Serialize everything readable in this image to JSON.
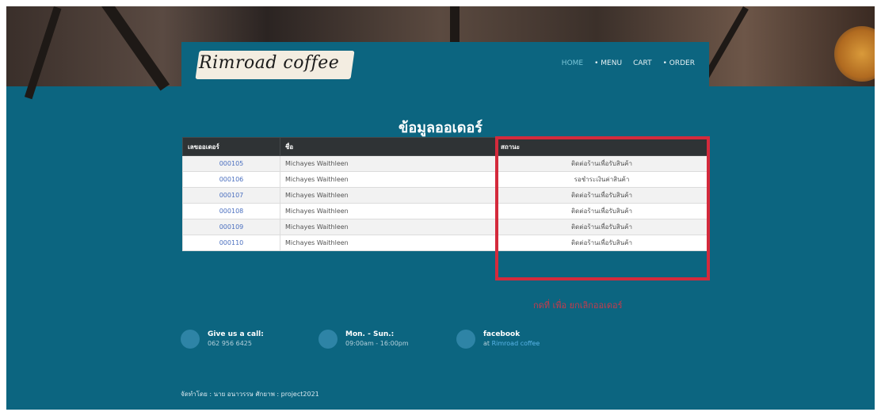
{
  "brand": {
    "logo_text": "Rimroad coffee"
  },
  "nav": {
    "items": [
      "HOME",
      "MENU",
      "CART",
      "ORDER"
    ]
  },
  "page_title": "ข้อมูลออเดอร์",
  "table": {
    "headers": [
      "เลขออเดอร์",
      "ชื่อ",
      "สถานะ"
    ],
    "rows": [
      {
        "number": "000105",
        "name": "Michayes Waithleen",
        "status": "ติดต่อร้านเพื่อรับสินค้า"
      },
      {
        "number": "000106",
        "name": "Michayes Waithleen",
        "status": "รอชำระเงินค่าสินค้า"
      },
      {
        "number": "000107",
        "name": "Michayes Waithleen",
        "status": "ติดต่อร้านเพื่อรับสินค้า"
      },
      {
        "number": "000108",
        "name": "Michayes Waithleen",
        "status": "ติดต่อร้านเพื่อรับสินค้า"
      },
      {
        "number": "000109",
        "name": "Michayes Waithleen",
        "status": "ติดต่อร้านเพื่อรับสินค้า"
      },
      {
        "number": "000110",
        "name": "Michayes Waithleen",
        "status": "ติดต่อร้านเพื่อรับสินค้า"
      }
    ]
  },
  "cancel_link": "กดที่ เพื่อ ยกเลิกออเดอร์",
  "contacts": [
    {
      "title": "Give us a call:",
      "sub": "062 956 6425"
    },
    {
      "title": "Mon. - Sun.:",
      "sub": "09:00am - 16:00pm"
    },
    {
      "title": "facebook",
      "sub": "at",
      "link": "Rimroad coffee"
    }
  ],
  "footer": "จัดทำโดย : นาย อนาวรรษ ศักยาพ : project2021",
  "colors": {
    "primary": "#0c6580",
    "table_header": "#2f3335",
    "highlight": "#d42a3c"
  }
}
